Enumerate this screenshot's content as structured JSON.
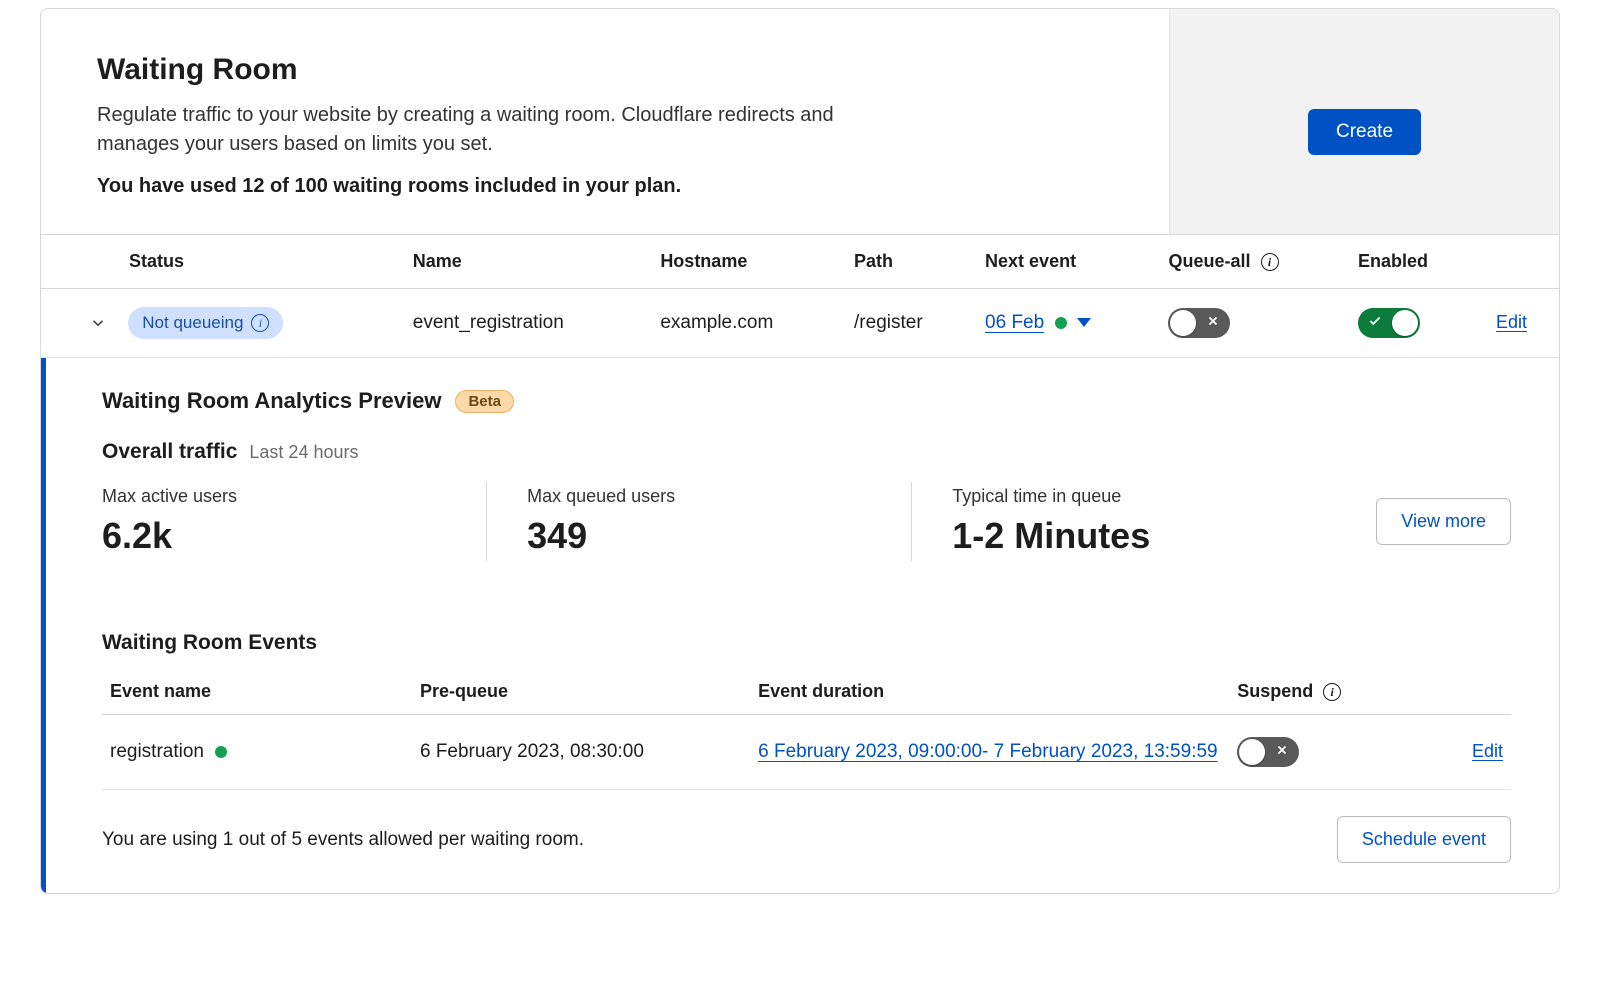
{
  "header": {
    "title": "Waiting Room",
    "description": "Regulate traffic to your website by creating a waiting room. Cloudflare redirects and manages your users based on limits you set.",
    "usage_line": "You have used 12 of 100 waiting rooms included in your plan.",
    "create_button": "Create"
  },
  "table": {
    "columns": {
      "status": "Status",
      "name": "Name",
      "hostname": "Hostname",
      "path": "Path",
      "next_event": "Next event",
      "queue_all": "Queue-all",
      "enabled": "Enabled"
    },
    "row": {
      "status_label": "Not queueing",
      "name": "event_registration",
      "hostname": "example.com",
      "path": "/register",
      "next_event": "06 Feb",
      "queue_all_on": false,
      "enabled_on": true,
      "edit_label": "Edit"
    }
  },
  "expansion": {
    "analytics_title": "Waiting Room Analytics Preview",
    "beta_label": "Beta",
    "overall_label": "Overall traffic",
    "overall_sub": "Last 24 hours",
    "stats": {
      "max_active_label": "Max active users",
      "max_active_value": "6.2k",
      "max_queued_label": "Max queued users",
      "max_queued_value": "349",
      "typical_label": "Typical time in queue",
      "typical_value": "1-2 Minutes"
    },
    "view_more": "View more",
    "events_title": "Waiting Room Events",
    "events_columns": {
      "name": "Event name",
      "prequeue": "Pre-queue",
      "duration": "Event duration",
      "suspend": "Suspend"
    },
    "event_row": {
      "name": "registration",
      "prequeue": "6 February 2023, 08:30:00",
      "duration": "6 February 2023, 09:00:00- 7 February 2023, 13:59:59",
      "suspend_on": false,
      "edit_label": "Edit"
    },
    "footer_msg": "You are using 1 out of 5 events allowed per waiting room.",
    "schedule_button": "Schedule event"
  }
}
